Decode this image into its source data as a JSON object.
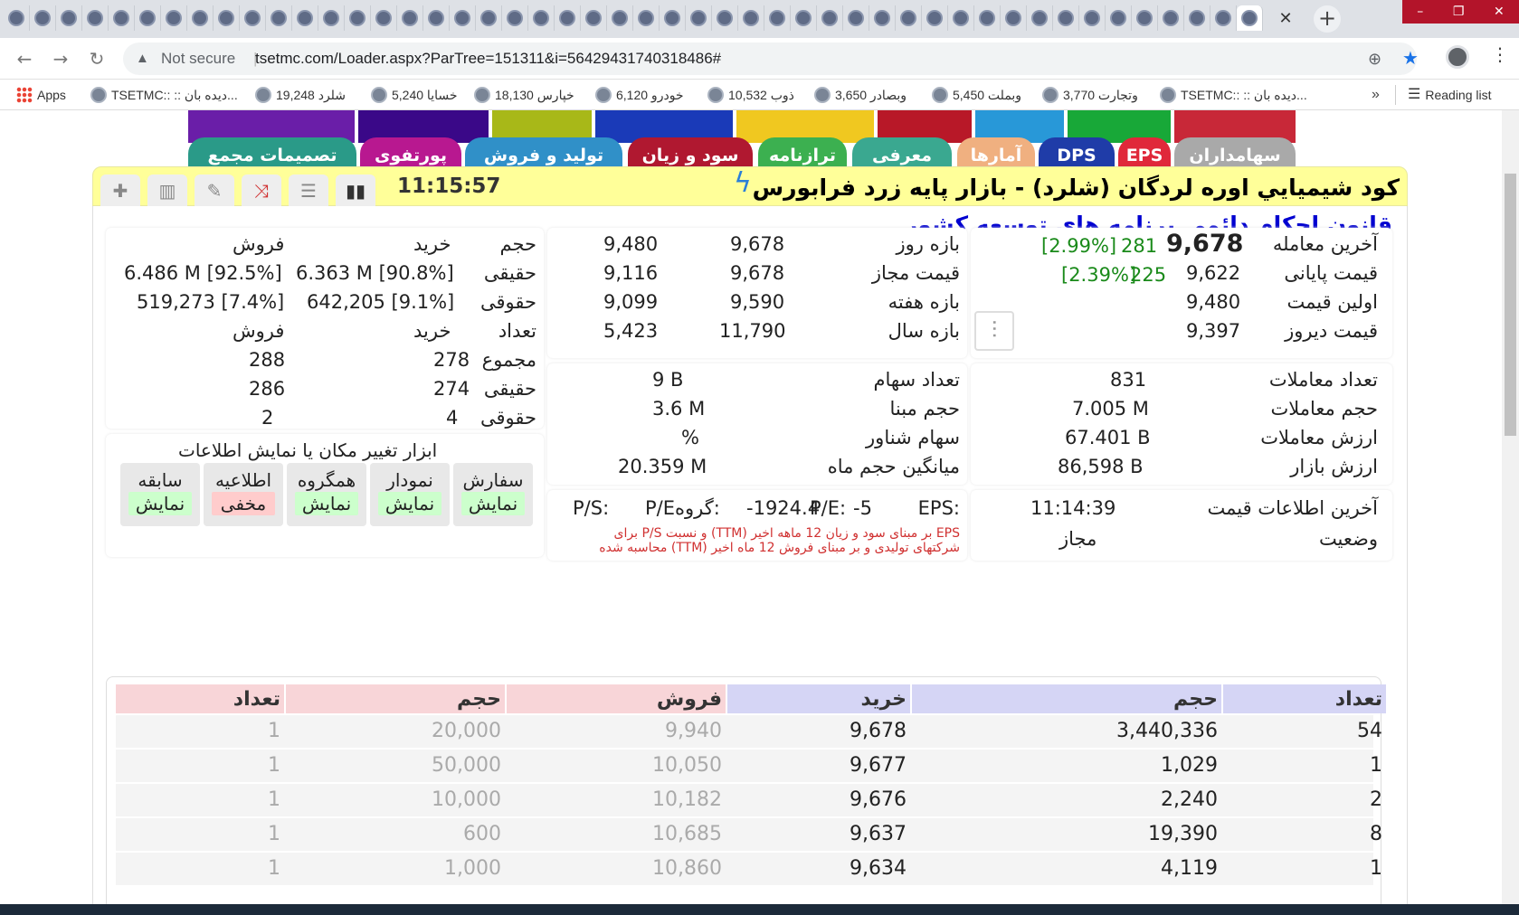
{
  "browser": {
    "close_tab": "✕",
    "new_tab": "+",
    "win_controls": [
      "–",
      "❐",
      "✕"
    ],
    "not_secure": "Not secure",
    "separator": "|",
    "url": "tsetmc.com/Loader.aspx?ParTree=151311&i=56429431740318486#",
    "bookmarks": [
      {
        "label": "Apps"
      },
      {
        "label": "TSETMC:: :: دیده بان..."
      },
      {
        "label": "شلرد 19,248"
      },
      {
        "label": "خسایا 5,240"
      },
      {
        "label": "خپارس 18,130"
      },
      {
        "label": "خودرو 6,120"
      },
      {
        "label": "ذوب 10,532"
      },
      {
        "label": "وبصادر 3,650"
      },
      {
        "label": "وبملت 5,450"
      },
      {
        "label": "وتجارت 3,770"
      },
      {
        "label": "TSETMC:: :: دیده بان..."
      }
    ],
    "more_bookmarks": "»",
    "reading_list": "Reading list"
  },
  "page_tabs": [
    {
      "label": "سهامداران",
      "color": "#a9a9a9"
    },
    {
      "label": "EPS",
      "color": "#e0283a"
    },
    {
      "label": "DPS",
      "color": "#1f3ca8"
    },
    {
      "label": "آمارها",
      "color": "#f0b080"
    },
    {
      "label": "معرفی",
      "color": "#3aa890"
    },
    {
      "label": "ترازنامه",
      "color": "#3cb050"
    },
    {
      "label": "سود و زیان",
      "color": "#b01830"
    },
    {
      "label": "تولید و فروش",
      "color": "#3090c8"
    },
    {
      "label": "پورتفوی",
      "color": "#b81890"
    },
    {
      "label": "تصمیمات مجمع",
      "color": "#2a9a88"
    }
  ],
  "header": {
    "title": "كود شيميايي اوره لردگان (شلرد) - بازار پایه زرد فرابورس",
    "time": "11:15:57",
    "subtitle": "قانون احکام دائمی برنامه های توسعه کشور"
  },
  "price": {
    "last_trade_label": "آخرین معامله",
    "last_trade": "9,678",
    "last_trade_change": "281",
    "last_trade_pct": "[2.99%]",
    "final_price_label": "قیمت پایانی",
    "final_price": "9,622",
    "final_change": "225",
    "final_pct": "[2.39%]",
    "first_price_label": "اولین قیمت",
    "first_price": "9,480",
    "yesterday_label": "قیمت دیروز",
    "yesterday": "9,397"
  },
  "ranges": {
    "day_label": "بازه روز",
    "day": [
      "9,678",
      "9,480"
    ],
    "allowed_label": "قیمت مجاز",
    "allowed": [
      "9,678",
      "9,116"
    ],
    "week_label": "بازه هفته",
    "week": [
      "9,590",
      "9,099"
    ],
    "year_label": "بازه سال",
    "year": [
      "11,790",
      "5,423"
    ]
  },
  "stats": {
    "trades_count_label": "تعداد معاملات",
    "trades_count": "831",
    "trades_volume_label": "حجم معاملات",
    "trades_volume": "7.005 M",
    "trades_value_label": "ارزش معاملات",
    "trades_value": "67.401 B",
    "market_value_label": "ارزش بازار",
    "market_value": "86,598 B",
    "shares_label": "تعداد سهام",
    "shares": "9 B",
    "base_volume_label": "حجم مبنا",
    "base_volume": "3.6 M",
    "float_label": "سهام شناور",
    "float": "%",
    "avg_month_label": "میانگین حجم ماه",
    "avg_month": "20.359 M"
  },
  "info": {
    "last_info_label": "آخرین اطلاعات قیمت",
    "last_info_time": "11:14:39",
    "status_label": "وضعیت",
    "status": "مجاز",
    "eps_row": [
      "EPS:",
      "-5",
      "P/E:",
      "-1924.4",
      "P/Eگروه:",
      "P/S:"
    ],
    "note1": "EPS بر مبنای سود و زیان 12 ماهه اخیر (TTM) و نسبت P/S برای",
    "note2": "شرکتهای تولیدی و بر مبنای فروش 12 ماه اخیر (TTM) محاسبه شده"
  },
  "clients": {
    "volume": "حجم",
    "buy": "خرید",
    "sell": "فروش",
    "real": "حقیقی",
    "legal": "حقوقی",
    "count": "تعداد",
    "total": "مجموع",
    "real_buy_vol": "6.363 M [90.8%]",
    "real_sell_vol": "6.486 M [92.5%]",
    "legal_buy_vol": "642,205 [9.1%]",
    "legal_sell_vol": "519,273 [7.4%]",
    "total_buy": "278",
    "total_sell": "288",
    "real_buy_cnt": "274",
    "real_sell_cnt": "286",
    "legal_buy_cnt": "4",
    "legal_sell_cnt": "2"
  },
  "tools": {
    "title": "ابزار تغییر مکان یا نمایش اطلاعات",
    "buttons": [
      {
        "label": "سفارش",
        "state": "نمایش"
      },
      {
        "label": "نمودار",
        "state": "نمایش"
      },
      {
        "label": "همگروه",
        "state": "نمایش"
      },
      {
        "label": "اطلاعیه",
        "state": "مخفی"
      },
      {
        "label": "سابقه",
        "state": "نمایش"
      }
    ]
  },
  "orderbook": {
    "headers": [
      "تعداد",
      "حجم",
      "خرید",
      "فروش",
      "حجم",
      "تعداد"
    ],
    "rows": [
      {
        "buy_count": "54",
        "buy_vol": "3,440,336",
        "buy_price": "9,678",
        "sell_price": "9,940",
        "sell_vol": "20,000",
        "sell_count": "1"
      },
      {
        "buy_count": "1",
        "buy_vol": "1,029",
        "buy_price": "9,677",
        "sell_price": "10,050",
        "sell_vol": "50,000",
        "sell_count": "1"
      },
      {
        "buy_count": "2",
        "buy_vol": "2,240",
        "buy_price": "9,676",
        "sell_price": "10,182",
        "sell_vol": "10,000",
        "sell_count": "1"
      },
      {
        "buy_count": "8",
        "buy_vol": "19,390",
        "buy_price": "9,637",
        "sell_price": "10,685",
        "sell_vol": "600",
        "sell_count": "1"
      },
      {
        "buy_count": "1",
        "buy_vol": "4,119",
        "buy_price": "9,634",
        "sell_price": "10,860",
        "sell_vol": "1,000",
        "sell_count": "1"
      }
    ]
  }
}
